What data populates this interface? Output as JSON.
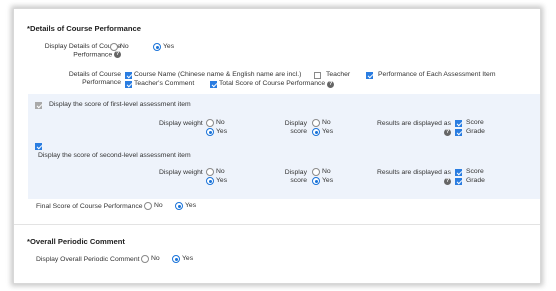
{
  "details": {
    "title": "*Details of Course Performance",
    "display_label_1": "Display Details of Course",
    "display_label_2": "Performance",
    "no": "No",
    "yes": "Yes",
    "items_label_1": "Details of Course",
    "items_label_2": "Performance",
    "items": {
      "course_name": "Course Name (Chinese name & English name are incl.)",
      "teacher": "Teacher",
      "each_assessment": "Performance of Each Assessment Item",
      "teacher_comment": "Teacher's Comment",
      "total_score": "Total Score of Course Performance"
    }
  },
  "first_level": {
    "label": "Display the score of first-level assessment item",
    "display_weight": "Display weight",
    "display_score_1": "Display",
    "display_score_2": "score",
    "no": "No",
    "yes": "Yes",
    "results_label": "Results are displayed as",
    "score": "Score",
    "grade": "Grade"
  },
  "second_level": {
    "label": "Display the score of second-level assessment item",
    "display_weight": "Display weight",
    "display_score_1": "Display",
    "display_score_2": "score",
    "no": "No",
    "yes": "Yes",
    "results_label": "Results are displayed as",
    "score": "Score",
    "grade": "Grade"
  },
  "final_score": {
    "label": "Final Score of Course Performance",
    "no": "No",
    "yes": "Yes"
  },
  "periodic": {
    "title": "*Overall Periodic Comment",
    "label": "Display Overall Periodic Comment",
    "no": "No",
    "yes": "Yes"
  },
  "icons": {
    "help": "question-mark-icon",
    "help_glyph": "?"
  },
  "colors": {
    "accent": "#1a73d9",
    "band": "#eef3fb"
  }
}
